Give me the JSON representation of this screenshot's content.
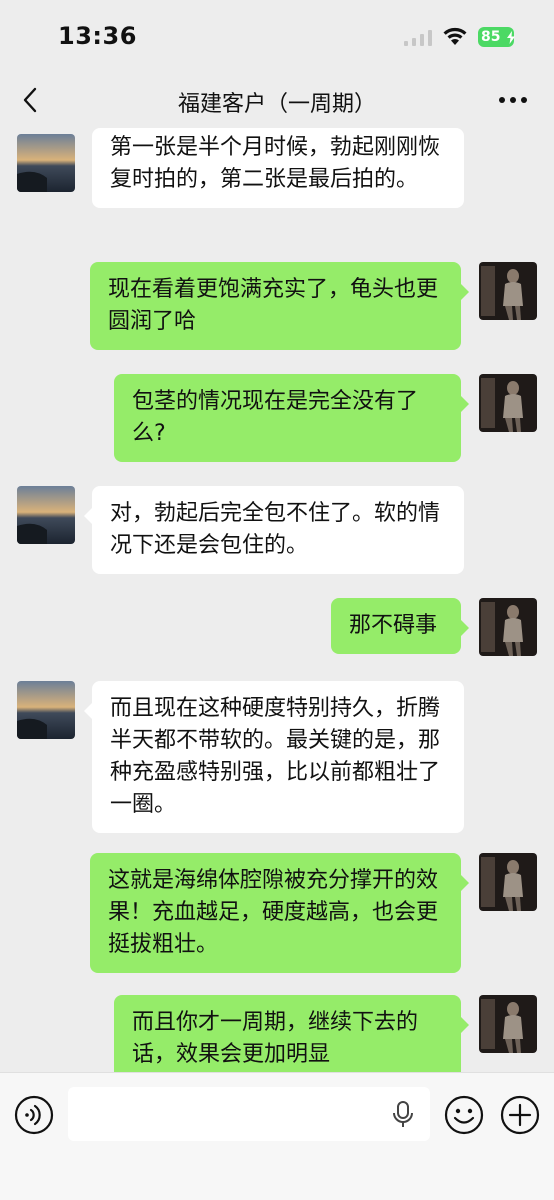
{
  "status_bar": {
    "time": "13:36",
    "battery": "85"
  },
  "nav": {
    "title": "福建客户（一周期）",
    "back_icon": "chevron-left-icon",
    "more_icon": "ellipsis-icon"
  },
  "colors": {
    "outgoing_bubble": "#95ec69",
    "incoming_bubble": "#ffffff",
    "background": "#ededed",
    "battery": "#4cd964"
  },
  "messages": [
    {
      "direction": "in",
      "text": "第一张是半个月时候，勃起刚刚恢复时拍的，第二张是最后拍的。"
    },
    {
      "direction": "out",
      "text": "现在看着更饱满充实了，龟头也更圆润了哈"
    },
    {
      "direction": "out",
      "text": "包茎的情况现在是完全没有了么?"
    },
    {
      "direction": "in",
      "text": "对，勃起后完全包不住了。软的情况下还是会包住的。"
    },
    {
      "direction": "out",
      "text": "那不碍事"
    },
    {
      "direction": "in",
      "text": "而且现在这种硬度特别持久，折腾半天都不带软的。最关键的是，那种充盈感特别强，比以前都粗壮了一圈。"
    },
    {
      "direction": "out",
      "text": "这就是海绵体腔隙被充分撑开的效果！充血越足，硬度越高，也会更挺拔粗壮。"
    },
    {
      "direction": "out",
      "text": "而且你才一周期，继续下去的话，效果会更加明显"
    }
  ],
  "input_bar": {
    "value": "",
    "voice_icon": "voice-icon",
    "mic_icon": "microphone-icon",
    "emoji_icon": "emoji-icon",
    "plus_icon": "plus-icon"
  }
}
